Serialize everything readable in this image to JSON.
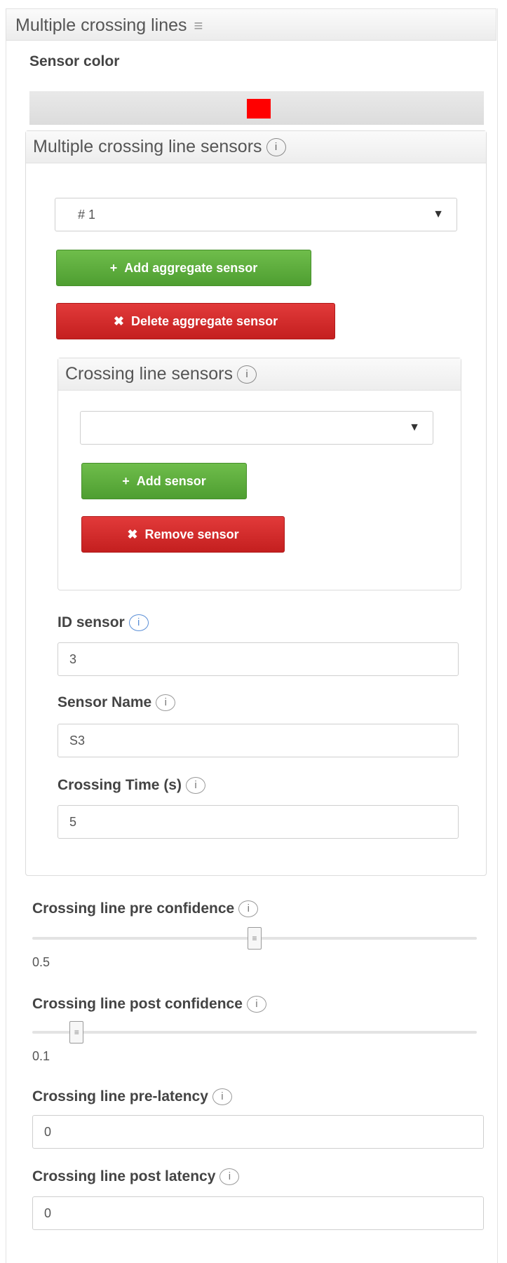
{
  "section": {
    "title": "Multiple crossing lines",
    "menu_glyph": "≡"
  },
  "sensor_color": {
    "label": "Sensor color",
    "color": "#ff0000"
  },
  "multi_panel": {
    "title": "Multiple crossing line sensors",
    "info_glyph": "i",
    "select_value": "# 1",
    "add_label": "Add aggregate sensor",
    "delete_label": "Delete aggregate sensor"
  },
  "crossing_panel": {
    "title": "Crossing line sensors",
    "info_glyph": "i",
    "select_value": "",
    "add_label": "Add sensor",
    "remove_label": "Remove sensor"
  },
  "fields": {
    "id_sensor": {
      "label": "ID sensor",
      "value": "3"
    },
    "sensor_name": {
      "label": "Sensor Name",
      "value": "S3"
    },
    "crossing_time": {
      "label": "Crossing Time (s)",
      "value": "5"
    }
  },
  "sliders": {
    "pre_confidence": {
      "label": "Crossing line pre confidence",
      "value": 0.5,
      "display": "0.5"
    },
    "post_confidence": {
      "label": "Crossing line post confidence",
      "value": 0.1,
      "display": "0.1"
    }
  },
  "latency": {
    "pre": {
      "label": "Crossing line pre-latency",
      "value": "0"
    },
    "post": {
      "label": "Crossing line post latency",
      "value": "0"
    }
  },
  "icons": {
    "info": "i",
    "dropdown": "▼",
    "plus": "+",
    "times": "✖",
    "slider_grip": "≡"
  },
  "colors": {
    "green": "#5cab3c",
    "red": "#d62828"
  }
}
